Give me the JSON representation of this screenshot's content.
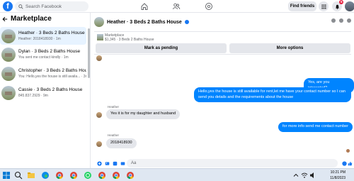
{
  "topbar": {
    "search_placeholder": "Search Facebook",
    "find_friends": "Find friends",
    "notifications_count": "5"
  },
  "sidebar": {
    "title": "Marketplace",
    "conversations": [
      {
        "name": "Heather · 3 Beds 2 Baths House",
        "preview": "Heather: 2018418930 · 1m",
        "active": true
      },
      {
        "name": "Dylan · 3 Beds 2 Baths House",
        "preview": "You sent me contact kindly · 1m"
      },
      {
        "name": "Christopher · 3 Beds 2 Baths House",
        "preview": "You: Hello,yes the house is still availa... · 3m"
      },
      {
        "name": "Cassie · 3 Beds 2 Baths House",
        "preview": "845.837.2929 · 9m"
      }
    ]
  },
  "chat": {
    "title": "Heather · 3 Beds 2 Baths House",
    "listing_label": "Marketplace",
    "listing_price": "$1,345 · 3 Beds 2 Baths House",
    "mark_pending": "Mark as pending",
    "more_options": "More options",
    "messages": {
      "m1": "Yes, are you interested?",
      "m2": "Hello,yes the house is still available for rent,let me have your contact number so I can send you details and the requirements about the house",
      "sender1": "Heather",
      "m3": "Yes it is for my daughter and husband",
      "m4": "for more info send me contact number",
      "sender2": "Heather",
      "m5": "2018418930"
    },
    "composer_placeholder": "Aa"
  },
  "taskbar": {
    "time": "10:21 PM",
    "date": "11/8/2023"
  },
  "colors": {
    "brand": "#1877f2",
    "outgoing_bubble": "#0084ff",
    "incoming_bubble": "#e4e6eb"
  }
}
